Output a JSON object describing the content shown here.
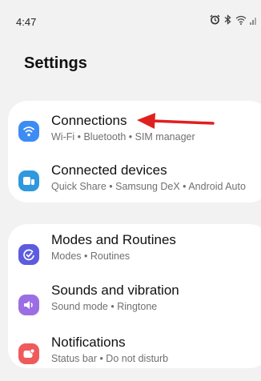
{
  "status_bar": {
    "time": "4:47",
    "icons": [
      "alarm-icon",
      "bluetooth-icon",
      "wifi-icon",
      "signal-icon"
    ]
  },
  "page": {
    "title": "Settings"
  },
  "settings": {
    "items": [
      {
        "title": "Connections",
        "subtitle": "Wi-Fi • Bluetooth • SIM manager",
        "icon": "wifi-icon",
        "icon_color": "#3d8cf4"
      },
      {
        "title": "Connected devices",
        "subtitle": "Quick Share • Samsung DeX • Android Auto",
        "icon": "devices-icon",
        "icon_color": "#2f98de"
      },
      {
        "title": "Modes and Routines",
        "subtitle": "Modes • Routines",
        "icon": "check-circle-icon",
        "icon_color": "#5c5ce0"
      },
      {
        "title": "Sounds and vibration",
        "subtitle": "Sound mode • Ringtone",
        "icon": "speaker-icon",
        "icon_color": "#9b6fe3"
      },
      {
        "title": "Notifications",
        "subtitle": "Status bar • Do not disturb",
        "icon": "bell-badge-icon",
        "icon_color": "#ef5b5b"
      }
    ]
  },
  "annotation": {
    "color": "#e02020"
  }
}
